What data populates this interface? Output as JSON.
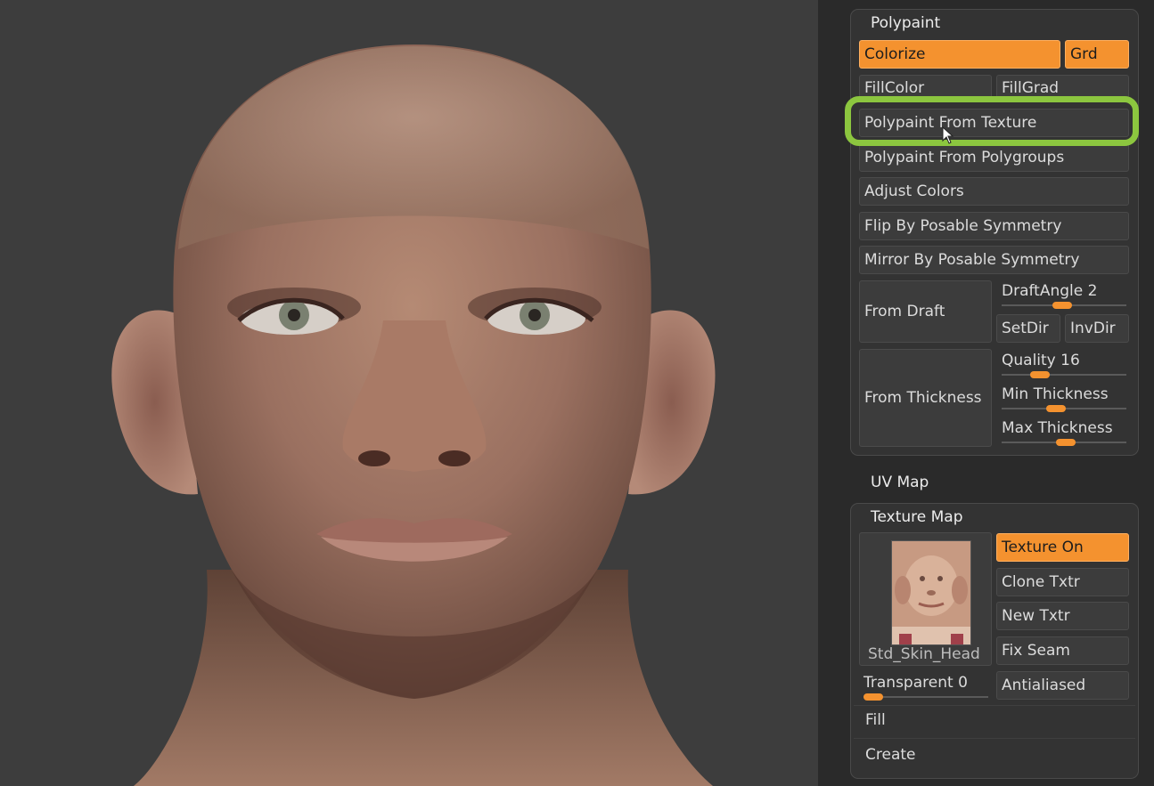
{
  "polypaint": {
    "title": "Polypaint",
    "colorize": "Colorize",
    "grd": "Grd",
    "fill_color": "FillColor",
    "fill_grad": "FillGrad",
    "from_texture": "Polypaint From Texture",
    "from_polygroups": "Polypaint From Polygroups",
    "adjust_colors": "Adjust Colors",
    "flip_symmetry": "Flip By Posable Symmetry",
    "mirror_symmetry": "Mirror By Posable Symmetry",
    "from_draft": "From Draft",
    "draft_angle": {
      "label": "DraftAngle",
      "value": "2",
      "level": 0.48
    },
    "set_dir": "SetDir",
    "inv_dir": "InvDir",
    "from_thickness": "From Thickness",
    "quality": {
      "label": "Quality",
      "value": "16",
      "level": 0.27
    },
    "min_thickness": {
      "label": "Min Thickness",
      "level": 0.42
    },
    "max_thickness": {
      "label": "Max Thickness",
      "level": 0.52
    }
  },
  "uv_map": {
    "title": "UV Map"
  },
  "texture_map": {
    "title": "Texture Map",
    "texture_name": "Std_Skin_Head",
    "texture_on": "Texture On",
    "clone_txtr": "Clone Txtr",
    "new_txtr": "New Txtr",
    "fix_seam": "Fix Seam",
    "transparent": {
      "label": "Transparent",
      "value": "0",
      "level": 0.0
    },
    "antialiased": "Antialiased",
    "fill": "Fill",
    "create": "Create"
  },
  "colors": {
    "accent": "#f4922f",
    "highlight": "#8cc63f"
  }
}
